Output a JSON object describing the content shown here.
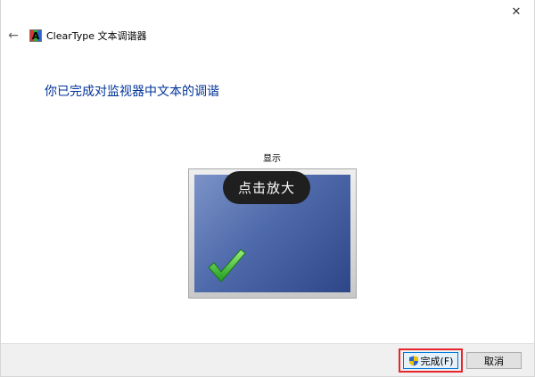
{
  "window": {
    "close_glyph": "✕"
  },
  "header": {
    "back_glyph": "←",
    "app_icon_letter": "A",
    "title": "ClearType 文本调谐器"
  },
  "main": {
    "heading": "你已完成对监视器中文本的调谐",
    "monitor_label": "显示",
    "zoom_tooltip": "点击放大"
  },
  "footer": {
    "finish_label": "完成(F)",
    "cancel_label": "取消"
  },
  "colors": {
    "heading": "#003399",
    "highlight": "#e8252c",
    "screen_dark": "#2d4687",
    "screen_light": "#7b93c7"
  }
}
